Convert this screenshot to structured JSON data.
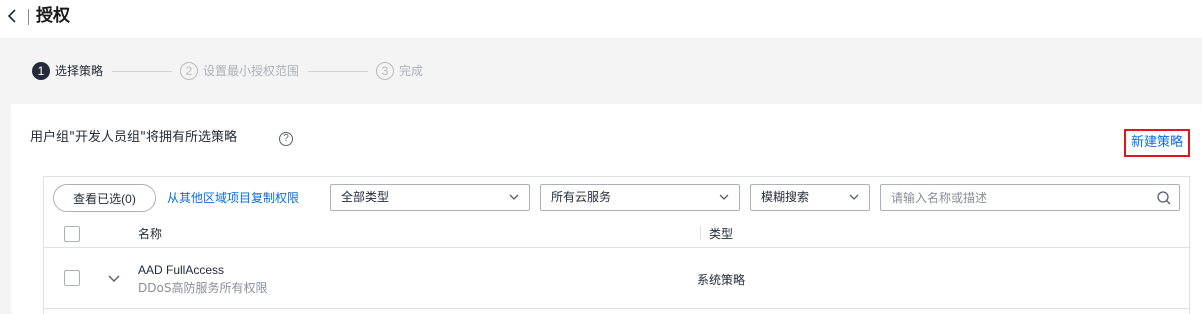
{
  "header": {
    "title": "授权"
  },
  "steps": [
    {
      "num": "1",
      "label": "选择策略",
      "active": true
    },
    {
      "num": "2",
      "label": "设置最小授权范围",
      "active": false
    },
    {
      "num": "3",
      "label": "完成",
      "active": false
    }
  ],
  "main": {
    "prompt": "用户组\"开发人员组\"将拥有所选策略",
    "help_glyph": "?",
    "new_policy_label": "新建策略"
  },
  "toolbar": {
    "view_selected_label": "查看已选(0)",
    "copy_permissions_label": "从其他区域项目复制权限",
    "type_filter": {
      "value": "全部类型"
    },
    "service_filter": {
      "value": "所有云服务"
    },
    "search_mode": {
      "value": "模糊搜索"
    },
    "search": {
      "placeholder": "请输入名称或描述",
      "value": ""
    }
  },
  "table": {
    "columns": [
      "名称",
      "类型"
    ],
    "rows": [
      {
        "name": "AAD FullAccess",
        "description": "DDoS高防服务所有权限",
        "type": "系统策略",
        "checked": false
      }
    ]
  },
  "colors": {
    "accent_link": "#0a6edc",
    "highlight_border": "#e0161e",
    "active_step": "#252b3a",
    "page_background": "#f4f4f4"
  }
}
